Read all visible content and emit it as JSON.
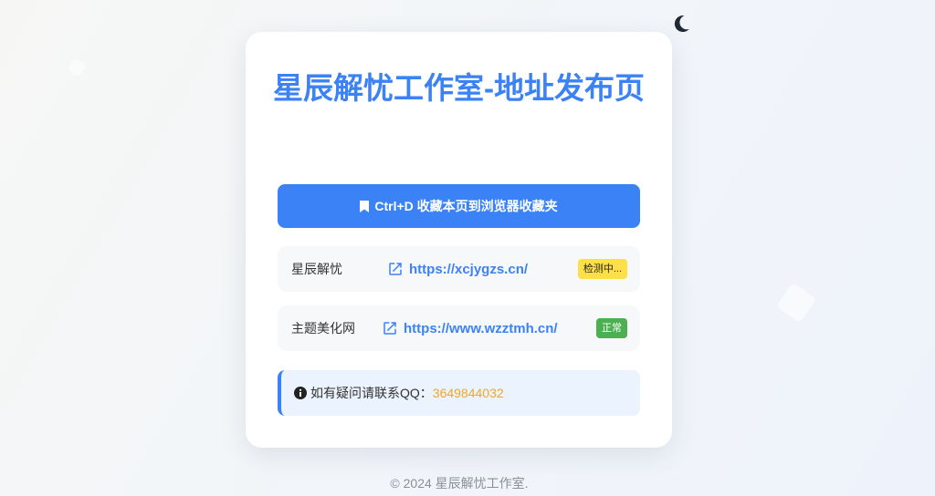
{
  "page": {
    "title": "星辰解忧工作室-地址发布页",
    "bookmark_label": "Ctrl+D 收藏本页到浏览器收藏夹"
  },
  "sites": [
    {
      "name": "星辰解忧",
      "url": "https://xcjygzs.cn/",
      "status": "检测中..."
    },
    {
      "name": "主题美化网",
      "url": "https://www.wzztmh.cn/",
      "status": "正常"
    }
  ],
  "notice": {
    "text": "如有疑问请联系QQ：",
    "qq": "3649844032"
  },
  "footer": {
    "text": "© 2024 星辰解忧工作室."
  },
  "icons": {
    "theme": "moon-icon",
    "bookmark": "bookmark-icon",
    "link": "external-link-icon",
    "info": "info-circle-icon"
  },
  "colors": {
    "accent": "#3b82f6",
    "status_checking": "#fde047",
    "status_ok": "#4caf50",
    "qq": "#f5a623"
  }
}
